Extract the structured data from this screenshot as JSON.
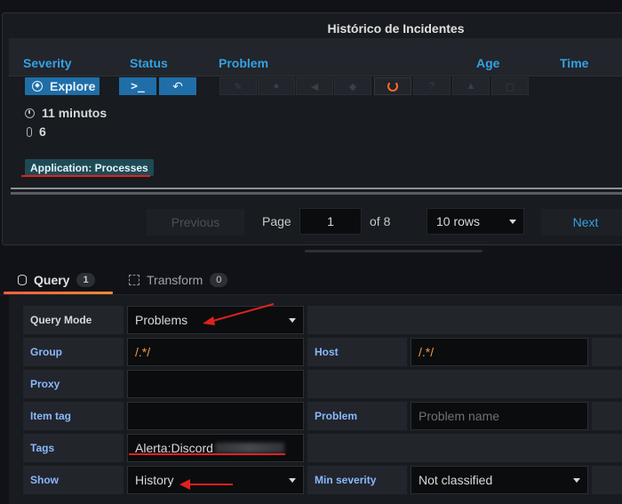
{
  "panel": {
    "title": "Histórico de Incidentes",
    "columns": [
      "Severity",
      "Status",
      "Problem",
      "Age",
      "Time"
    ],
    "row": {
      "explore_label": "Explore",
      "terminal_label": ">_",
      "back_label": "↶",
      "age_text": "11 minutos",
      "count_text": "6",
      "tag_label": "Application: Processes"
    }
  },
  "pagination": {
    "previous_label": "Previous",
    "page_label": "Page",
    "page_value": "1",
    "of_label": "of 8",
    "rows_value": "10 rows",
    "next_label": "Next"
  },
  "tabs": [
    {
      "label": "Query",
      "count": "1"
    },
    {
      "label": "Transform",
      "count": "0"
    }
  ],
  "query": {
    "query_mode_label": "Query Mode",
    "query_mode_value": "Problems",
    "group_label": "Group",
    "group_value": "/.*/",
    "host_label": "Host",
    "host_value": "/.*/",
    "proxy_label": "Proxy",
    "proxy_value": "",
    "item_tag_label": "Item tag",
    "item_tag_value": "",
    "problem_label": "Problem",
    "problem_placeholder": "Problem name",
    "tags_label": "Tags",
    "tags_value": "Alerta:Discord",
    "show_label": "Show",
    "show_value": "History",
    "min_severity_label": "Min severity",
    "min_severity_value": "Not classified"
  },
  "colors": {
    "accent_blue": "#33a2e5",
    "button_blue": "#1f6ea8",
    "tab_orange": "#f55f3e",
    "annotation_red": "#e0221e",
    "label_blue": "#8ab8ff"
  }
}
